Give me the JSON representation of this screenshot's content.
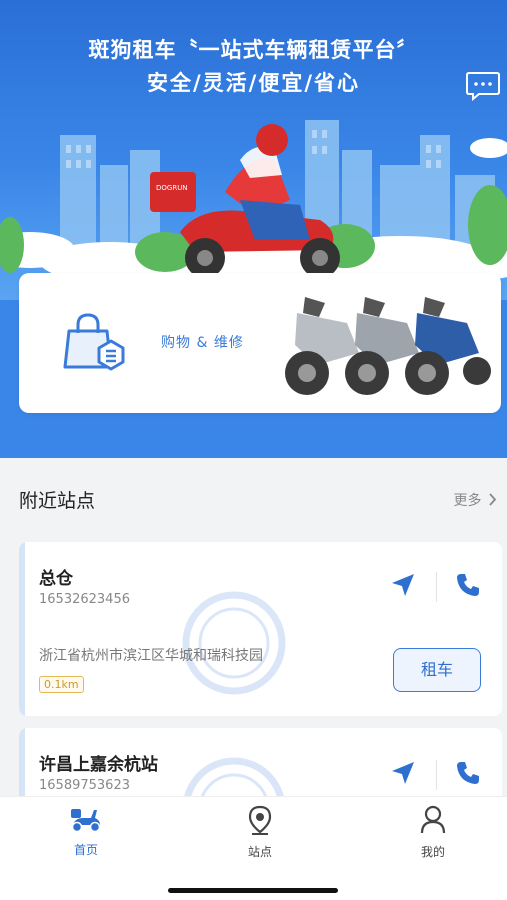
{
  "hero": {
    "title": "斑狗租车〝一站式车辆租赁平台〞",
    "subtitle": "安全/灵活/便宜/省心"
  },
  "shop_card": {
    "label": "购物 & 维修"
  },
  "nearby": {
    "title": "附近站点",
    "more": "更多"
  },
  "stations": [
    {
      "name": "总仓",
      "phone": "16532623456",
      "address": "浙江省杭州市滨江区华城和瑞科技园",
      "distance": "0.1km",
      "rent_label": "租车"
    },
    {
      "name": "许昌上嘉余杭站",
      "phone": "16589753623"
    }
  ],
  "tabs": [
    {
      "label": "首页",
      "icon": "scooter-icon",
      "active": true
    },
    {
      "label": "站点",
      "icon": "location-pin-icon",
      "active": false
    },
    {
      "label": "我的",
      "icon": "person-icon",
      "active": false
    }
  ],
  "colors": {
    "primary": "#2e6fcf",
    "hero_blue": "#3a86e8",
    "distance_badge": "#d09a20"
  }
}
